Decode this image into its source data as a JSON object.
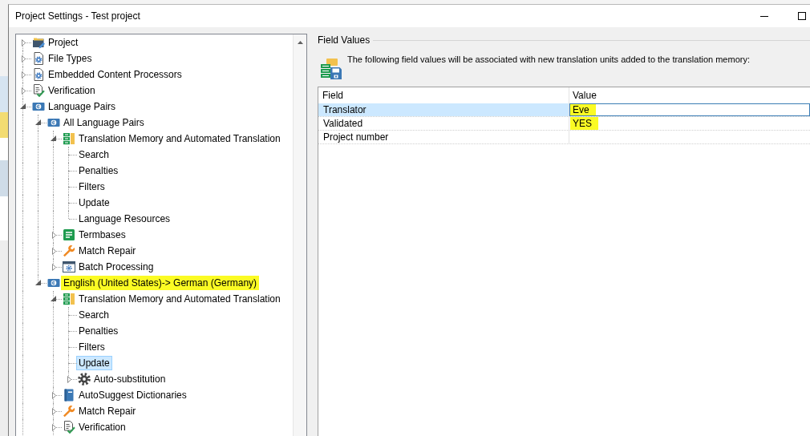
{
  "window": {
    "title": "Project Settings - Test project",
    "buttons": [
      {
        "kind": "minimize"
      },
      {
        "kind": "maximize"
      }
    ]
  },
  "tree": {
    "items": [
      {
        "label": "Project",
        "kind": "project",
        "expanded": false,
        "selected": false,
        "highlighted": false
      },
      {
        "label": "File Types",
        "kind": "filetypes",
        "expanded": false,
        "selected": false,
        "highlighted": false
      },
      {
        "label": "Embedded Content Processors",
        "kind": "filetypes",
        "expanded": false,
        "selected": false,
        "highlighted": false
      },
      {
        "label": "Verification",
        "kind": "verification",
        "expanded": false,
        "selected": false,
        "highlighted": false
      },
      {
        "label": "Language Pairs",
        "kind": "languages",
        "expanded": true,
        "selected": false,
        "highlighted": false,
        "children": [
          {
            "label": "All Language Pairs",
            "kind": "languages",
            "expanded": true,
            "selected": false,
            "highlighted": false,
            "children": [
              {
                "label": "Translation Memory and Automated Translation",
                "kind": "memory",
                "expanded": true,
                "selected": false,
                "highlighted": false,
                "children": [
                  {
                    "label": "Search",
                    "kind": "page",
                    "selected": false,
                    "highlighted": false
                  },
                  {
                    "label": "Penalties",
                    "kind": "page",
                    "selected": false,
                    "highlighted": false
                  },
                  {
                    "label": "Filters",
                    "kind": "page",
                    "selected": false,
                    "highlighted": false
                  },
                  {
                    "label": "Update",
                    "kind": "page",
                    "selected": false,
                    "highlighted": false
                  },
                  {
                    "label": "Language Resources",
                    "kind": "page",
                    "selected": false,
                    "highlighted": false
                  }
                ]
              },
              {
                "label": "Termbases",
                "kind": "termbase",
                "expanded": false,
                "selected": false,
                "highlighted": false
              },
              {
                "label": "Match Repair",
                "kind": "repair",
                "expanded": false,
                "selected": false,
                "highlighted": false
              },
              {
                "label": "Batch Processing",
                "kind": "batch",
                "expanded": false,
                "selected": false,
                "highlighted": false
              }
            ]
          },
          {
            "label": "English (United States)-> German (Germany)",
            "kind": "languages",
            "expanded": true,
            "selected": false,
            "highlighted": true,
            "children": [
              {
                "label": "Translation Memory and Automated Translation",
                "kind": "memory",
                "expanded": true,
                "selected": false,
                "highlighted": false,
                "children": [
                  {
                    "label": "Search",
                    "kind": "page",
                    "selected": false,
                    "highlighted": false
                  },
                  {
                    "label": "Penalties",
                    "kind": "page",
                    "selected": false,
                    "highlighted": false
                  },
                  {
                    "label": "Filters",
                    "kind": "page",
                    "selected": false,
                    "highlighted": false
                  },
                  {
                    "label": "Update",
                    "kind": "page",
                    "selected": true,
                    "highlighted": false
                  },
                  {
                    "label": "Auto-substitution",
                    "kind": "settings",
                    "expanded": false,
                    "selected": false,
                    "highlighted": false
                  }
                ]
              },
              {
                "label": "AutoSuggest Dictionaries",
                "kind": "dictionary",
                "expanded": false,
                "selected": false,
                "highlighted": false
              },
              {
                "label": "Match Repair",
                "kind": "repair",
                "expanded": false,
                "selected": false,
                "highlighted": false
              },
              {
                "label": "Verification",
                "kind": "verification",
                "expanded": false,
                "selected": false,
                "highlighted": false
              }
            ]
          }
        ]
      }
    ]
  },
  "field_values": {
    "title": "Field Values",
    "description": "The following field values will be associated with new translation units added to the translation memory:",
    "table": {
      "columns": [
        "Field",
        "Value"
      ],
      "rows": [
        {
          "field": "Translator",
          "value": "Eve",
          "selected": true,
          "highlighted": true
        },
        {
          "field": "Validated",
          "value": "YES",
          "selected": false,
          "highlighted": true
        },
        {
          "field": "Project number",
          "selected": false
        }
      ]
    }
  }
}
